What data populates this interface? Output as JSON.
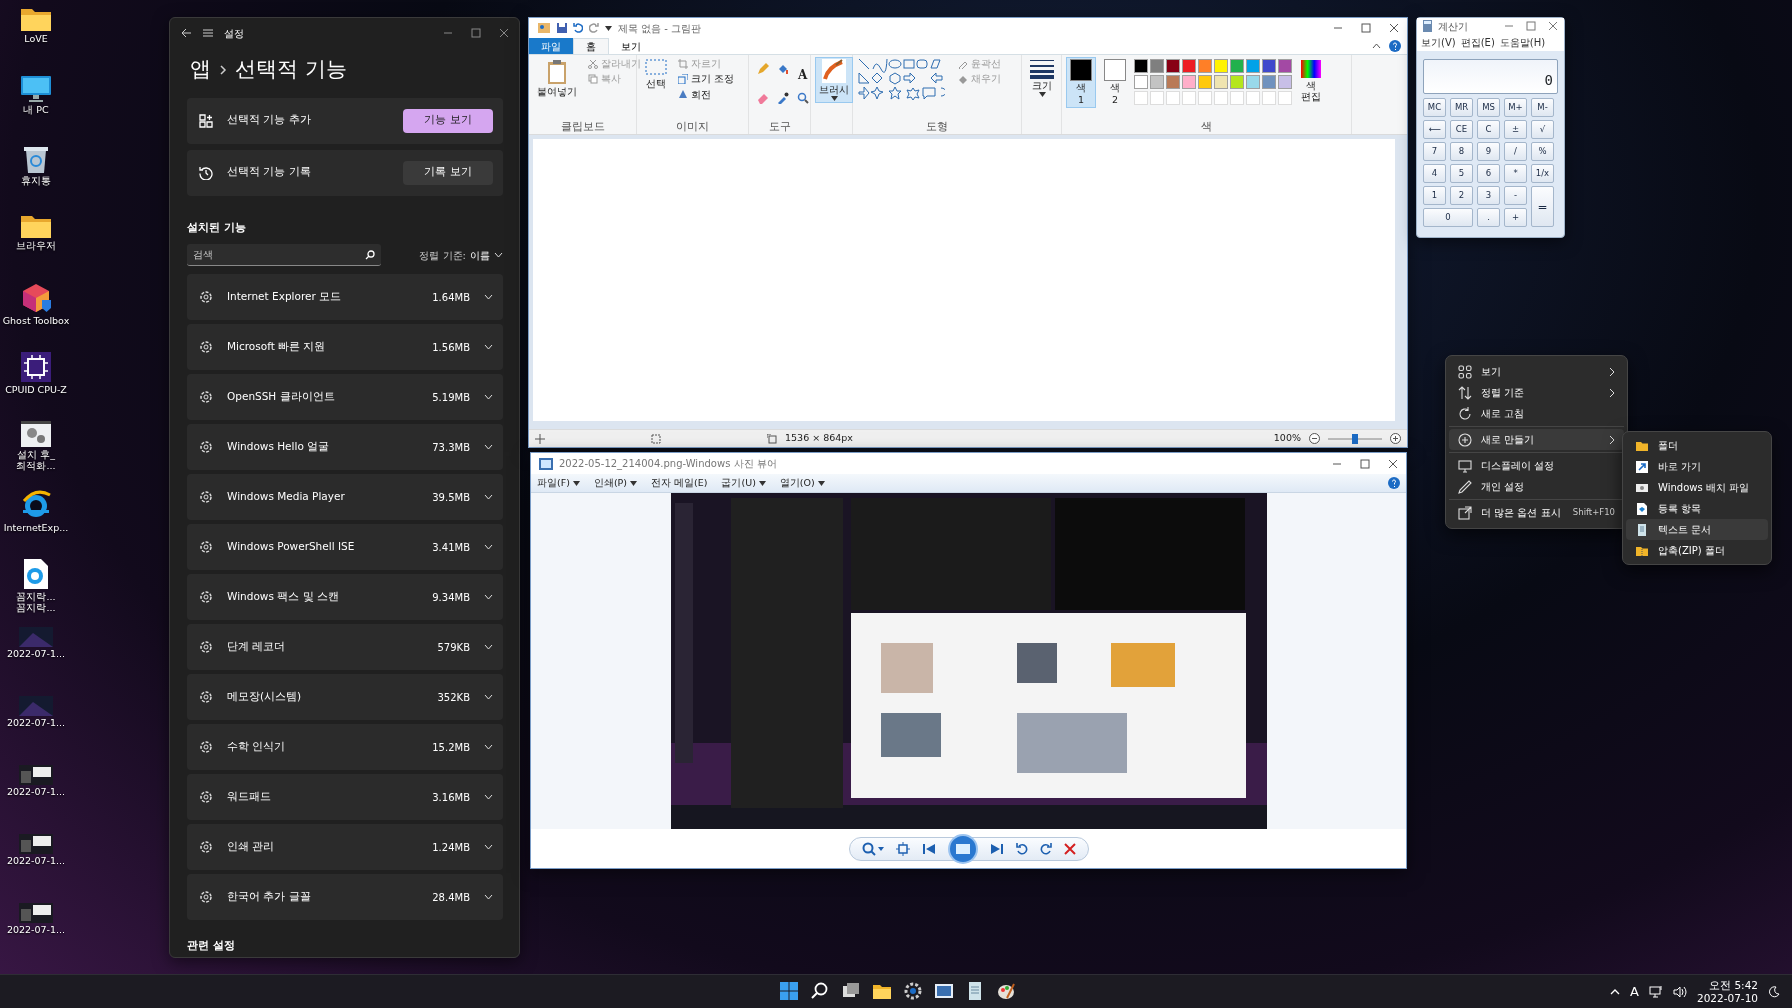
{
  "desktop_icons": [
    {
      "label": "LoVE",
      "kind": "folder"
    },
    {
      "label": "내 PC",
      "kind": "pc"
    },
    {
      "label": "휴지통",
      "kind": "bin"
    },
    {
      "label": "브라우저",
      "kind": "folder"
    },
    {
      "label": "Ghost Toolbox",
      "kind": "cube"
    },
    {
      "label": "CPUID CPU-Z",
      "kind": "chip"
    },
    {
      "label": "설치 후_최적화...",
      "kind": "gears"
    },
    {
      "label": "InternetExp...",
      "kind": "globe"
    },
    {
      "label": "꼼지락... 꼼지락...",
      "kind": "globe-doc"
    },
    {
      "label": "2022-07-1...",
      "kind": "wallpaper"
    },
    {
      "label": "2022-07-1...",
      "kind": "wallpaper"
    },
    {
      "label": "2022-07-1...",
      "kind": "screens"
    },
    {
      "label": "2022-07-1...",
      "kind": "screens"
    },
    {
      "label": "2022-07-1...",
      "kind": "screens"
    }
  ],
  "settings": {
    "title": "설정",
    "breadcrumb": "앱",
    "page_title": "선택적 기능",
    "actions": [
      {
        "label": "선택적 기능 추가",
        "button": "기능 보기",
        "kind": "add",
        "primary": true
      },
      {
        "label": "선택적 기능 기록",
        "button": "기록 보기",
        "kind": "history",
        "primary": false
      }
    ],
    "installed_heading": "설치된 기능",
    "search": {
      "placeholder": "검색"
    },
    "sort_label": "정렬 기준:",
    "sort_value": "이름",
    "features": [
      {
        "name": "Internet Explorer 모드",
        "size": "1.64MB"
      },
      {
        "name": "Microsoft 빠른 지원",
        "size": "1.56MB"
      },
      {
        "name": "OpenSSH 클라이언트",
        "size": "5.19MB"
      },
      {
        "name": "Windows Hello 얼굴",
        "size": "73.3MB"
      },
      {
        "name": "Windows Media Player",
        "size": "39.5MB"
      },
      {
        "name": "Windows PowerShell ISE",
        "size": "3.41MB"
      },
      {
        "name": "Windows 팩스 및 스캔",
        "size": "9.34MB"
      },
      {
        "name": "단계 레코더",
        "size": "579KB"
      },
      {
        "name": "메모장(시스템)",
        "size": "352KB"
      },
      {
        "name": "수학 인식기",
        "size": "15.2MB"
      },
      {
        "name": "워드패드",
        "size": "3.16MB"
      },
      {
        "name": "인쇄 관리",
        "size": "1.24MB"
      },
      {
        "name": "한국어 추가 글꼴",
        "size": "28.4MB"
      }
    ],
    "related_heading": "관련 설정"
  },
  "paint": {
    "title": "제목 없음 - 그림판",
    "tabs": [
      {
        "label": "파일",
        "kind": "file",
        "selected": false
      },
      {
        "label": "홈",
        "kind": "tab",
        "selected": true
      },
      {
        "label": "보기",
        "kind": "tab",
        "selected": false
      }
    ],
    "clipboard": {
      "paste": "붙여넣기",
      "cut": {
        "label": "잘라내기",
        "disabled": true
      },
      "copy": {
        "label": "복사",
        "disabled": true
      },
      "label": "클립보드"
    },
    "image": {
      "select": "선택",
      "crop": {
        "label": "자르기",
        "disabled": true
      },
      "resize": "크기 조정",
      "rotate": "회전",
      "label": "이미지"
    },
    "tools": {
      "text_tool": "A",
      "label": "도구"
    },
    "brush": {
      "label": "브러시",
      "selected": true
    },
    "shapes": {
      "outline": {
        "label": "윤곽선",
        "disabled": true
      },
      "fill": {
        "label": "채우기",
        "disabled": true
      },
      "label": "도형"
    },
    "size": {
      "label": "크기"
    },
    "color1": {
      "label": "색",
      "index": "1",
      "color": "#000000",
      "selected": true
    },
    "color2": {
      "label": "색",
      "index": "2",
      "color": "#ffffff",
      "selected": false
    },
    "palette": [
      {
        "color": "#000000"
      },
      {
        "color": "#7f7f7f"
      },
      {
        "color": "#880015"
      },
      {
        "color": "#ed1c24"
      },
      {
        "color": "#ff7f27"
      },
      {
        "color": "#fff200"
      },
      {
        "color": "#22b14c"
      },
      {
        "color": "#00a2e8"
      },
      {
        "color": "#3f48cc"
      },
      {
        "color": "#a349a4"
      },
      {
        "color": "#ffffff"
      },
      {
        "color": "#c3c3c3"
      },
      {
        "color": "#b97a57"
      },
      {
        "color": "#ffaec9"
      },
      {
        "color": "#ffc90e"
      },
      {
        "color": "#efe4b0"
      },
      {
        "color": "#b5e61d"
      },
      {
        "color": "#99d9ea"
      },
      {
        "color": "#7092be"
      },
      {
        "color": "#c8bfe7"
      }
    ],
    "edit_colors": "색 편집",
    "colors_label": "색",
    "dimensions": "1536 × 864px",
    "zoom": "100%",
    "zoom_slider": {
      "level": 0.5
    }
  },
  "photo_viewer": {
    "title": "2022-05-12_214004.png-Windows 사진 뷰어",
    "menus": [
      {
        "label": "파일(F)",
        "dropdown": true
      },
      {
        "label": "인쇄(P)",
        "dropdown": true
      },
      {
        "label": "전자 메일(E)",
        "dropdown": false
      },
      {
        "label": "굽기(U)",
        "dropdown": true
      },
      {
        "label": "열기(O)",
        "dropdown": true
      }
    ]
  },
  "calculator": {
    "title": "계산기",
    "menus": [
      "보기(V)",
      "편집(E)",
      "도움말(H)"
    ],
    "display": "0",
    "keys": [
      {
        "label": "MC",
        "kind": "normal"
      },
      {
        "label": "MR",
        "kind": "normal"
      },
      {
        "label": "MS",
        "kind": "normal"
      },
      {
        "label": "M+",
        "kind": "normal"
      },
      {
        "label": "M-",
        "kind": "normal"
      },
      {
        "label": "⟵",
        "kind": "normal"
      },
      {
        "label": "CE",
        "kind": "normal"
      },
      {
        "label": "C",
        "kind": "normal"
      },
      {
        "label": "±",
        "kind": "normal"
      },
      {
        "label": "√",
        "kind": "normal"
      },
      {
        "label": "7",
        "kind": "normal"
      },
      {
        "label": "8",
        "kind": "normal"
      },
      {
        "label": "9",
        "kind": "normal"
      },
      {
        "label": "/",
        "kind": "normal"
      },
      {
        "label": "%",
        "kind": "normal"
      },
      {
        "label": "4",
        "kind": "normal"
      },
      {
        "label": "5",
        "kind": "normal"
      },
      {
        "label": "6",
        "kind": "normal"
      },
      {
        "label": "*",
        "kind": "normal"
      },
      {
        "label": "1/x",
        "kind": "normal"
      },
      {
        "label": "1",
        "kind": "normal"
      },
      {
        "label": "2",
        "kind": "normal"
      },
      {
        "label": "3",
        "kind": "normal"
      },
      {
        "label": "-",
        "kind": "normal"
      },
      {
        "label": "=",
        "kind": "tall"
      },
      {
        "label": "0",
        "kind": "wide"
      },
      {
        "label": ".",
        "kind": "normal"
      },
      {
        "label": "+",
        "kind": "normal"
      }
    ]
  },
  "context_menu": {
    "groups": [
      {
        "items": [
          {
            "label": "보기",
            "kind": "grid",
            "submenu": true,
            "selected": false
          },
          {
            "label": "정렬 기준",
            "kind": "sort",
            "submenu": true,
            "selected": false
          },
          {
            "label": "새로 고침",
            "kind": "refresh",
            "submenu": false,
            "selected": false
          }
        ]
      },
      {
        "items": [
          {
            "label": "새로 만들기",
            "kind": "new",
            "submenu": true,
            "selected": true
          }
        ]
      },
      {
        "items": [
          {
            "label": "디스플레이 설정",
            "kind": "display",
            "submenu": false,
            "selected": false
          },
          {
            "label": "개인 설정",
            "kind": "brush",
            "submenu": false,
            "selected": false
          }
        ]
      },
      {
        "items": [
          {
            "label": "더 많은 옵션 표시",
            "kind": "more",
            "submenu": false,
            "selected": false,
            "shortcut": "Shift+F10"
          }
        ]
      }
    ],
    "submenu": [
      {
        "label": "폴더",
        "kind": "folder",
        "selected": false
      },
      {
        "label": "바로 가기",
        "kind": "shortcut",
        "selected": false
      },
      {
        "label": "Windows 배치 파일",
        "kind": "batch",
        "selected": false
      },
      {
        "label": "등록 항목",
        "kind": "registry",
        "selected": false
      },
      {
        "label": "텍스트 문서",
        "kind": "text",
        "selected": true
      },
      {
        "label": "압축(ZIP) 폴더",
        "kind": "zip",
        "selected": false
      }
    ]
  },
  "taskbar": {
    "input_indicator": "A",
    "time": "오전 5:42",
    "date": "2022-07-10"
  }
}
